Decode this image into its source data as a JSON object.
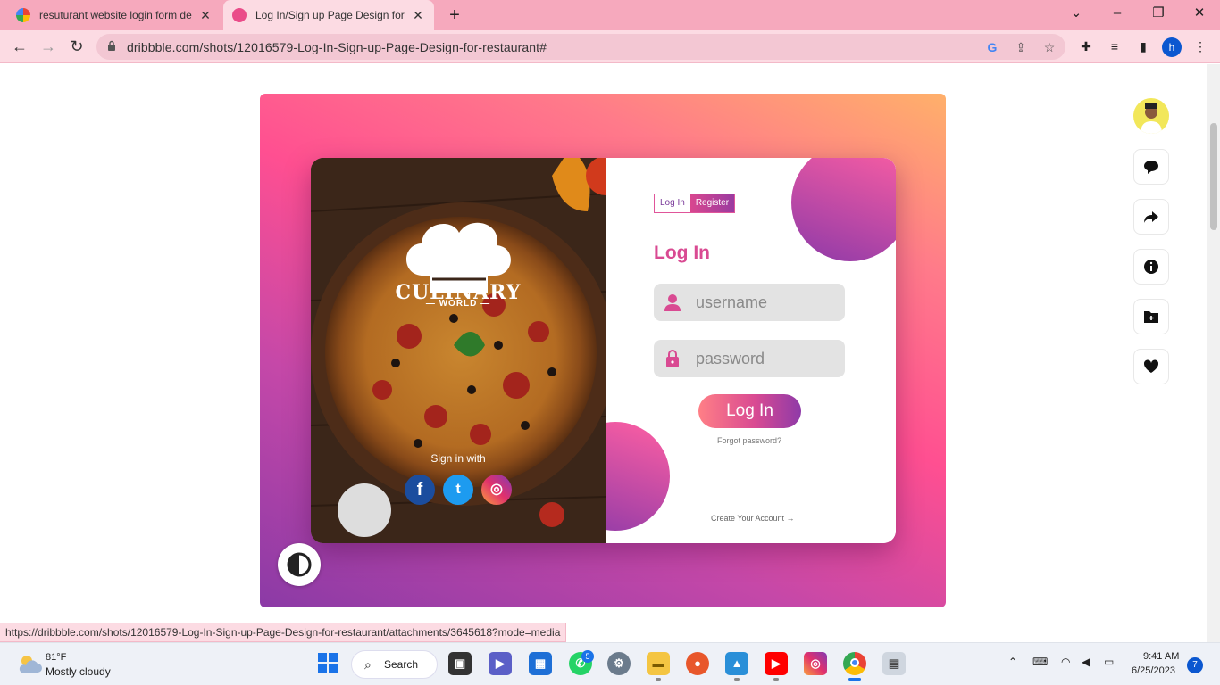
{
  "browser": {
    "tabs": [
      {
        "title": "resuturant website login form de",
        "active": false
      },
      {
        "title": "Log In/Sign up Page Design for r",
        "active": true
      }
    ],
    "url": "dribbble.com/shots/12016579-Log-In-Sign-up-Page-Design-for-restaurant#",
    "profile_initial": "h",
    "status_url": "https://dribbble.com/shots/12016579-Log-In-Sign-up-Page-Design-for-restaurant/attachments/3645618?mode=media"
  },
  "shot": {
    "brand": "CULINARY",
    "brand_sub": "— WORLD —",
    "sign_in_with": "Sign in with",
    "tab_login": "Log In",
    "tab_register": "Register",
    "heading": "Log In",
    "username_placeholder": "username",
    "password_placeholder": "password",
    "login_button": "Log In",
    "forgot": "Forgot password?",
    "create": "Create Your Account  →"
  },
  "taskbar": {
    "temp": "81°F",
    "weather": "Mostly cloudy",
    "search": "Search",
    "whatsapp_badge": "5",
    "time": "9:41 AM",
    "date": "6/25/2023",
    "notifications": "7"
  },
  "colors": {
    "accent_pink": "#d94a92",
    "accent_purple": "#8e3aa8",
    "tab_strip": "#f6a9bd"
  }
}
